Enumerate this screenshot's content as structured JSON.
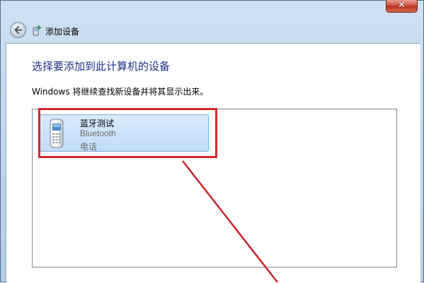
{
  "window": {
    "title": "添加设备",
    "close_glyph": "✕"
  },
  "header": {
    "back_icon": "back-arrow-icon",
    "wizard_icon": "add-device-icon",
    "title": "添加设备"
  },
  "main": {
    "instruction": "选择要添加到此计算机的设备",
    "description": "Windows 将继续查找新设备并将其显示出来。"
  },
  "device_list": {
    "items": [
      {
        "name": "蓝牙测试",
        "type": "Bluetooth",
        "category": "电话",
        "icon": "mobile-phone-icon",
        "selected": true
      }
    ]
  },
  "annotation": {
    "highlight_color": "#d2282e",
    "arrow_color": "#c9232a"
  }
}
